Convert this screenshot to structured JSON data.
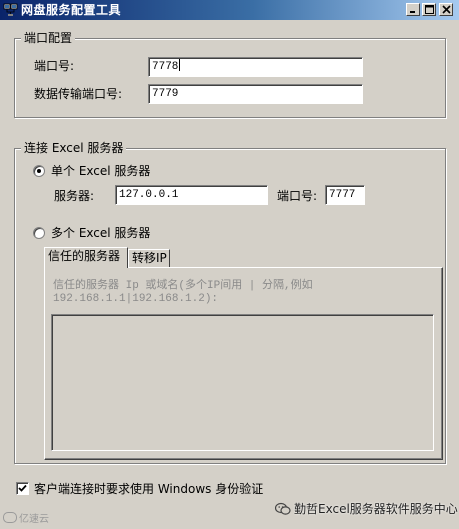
{
  "window": {
    "title": "网盘服务配置工具",
    "minimize_glyph": "_",
    "maximize_glyph": "□",
    "close_glyph": "×"
  },
  "port_config": {
    "group_title": "端口配置",
    "port_label": "端口号:",
    "port_value": "7778",
    "data_port_label": "数据传输端口号:",
    "data_port_value": "7779"
  },
  "excel_server": {
    "group_title": "连接 Excel 服务器",
    "single_label": "单个 Excel 服务器",
    "single_selected": true,
    "server_label": "服务器:",
    "server_value": "127.0.0.1",
    "port_label": "端口号:",
    "port_value": "7777",
    "multi_label": "多个 Excel 服务器",
    "multi_selected": false,
    "tabs": [
      {
        "label": "信任的服务器",
        "active": true
      },
      {
        "label": "转移IP",
        "active": false
      }
    ],
    "hint_line1": "信任的服务器 Ip 或域名(多个IP间用 | 分隔,例如",
    "hint_line2": "192.168.1.1|192.168.1.2):"
  },
  "windows_auth": {
    "label": "客户端连接时要求使用 Windows 身份验证",
    "checked": true
  },
  "watermarks": {
    "left": "亿速云",
    "right": "勤哲Excel服务器软件服务中心"
  },
  "colors": {
    "face": "#d4d0c8",
    "title_start": "#0a246a",
    "title_end": "#a6caf0",
    "hint": "#8a8a8a"
  }
}
